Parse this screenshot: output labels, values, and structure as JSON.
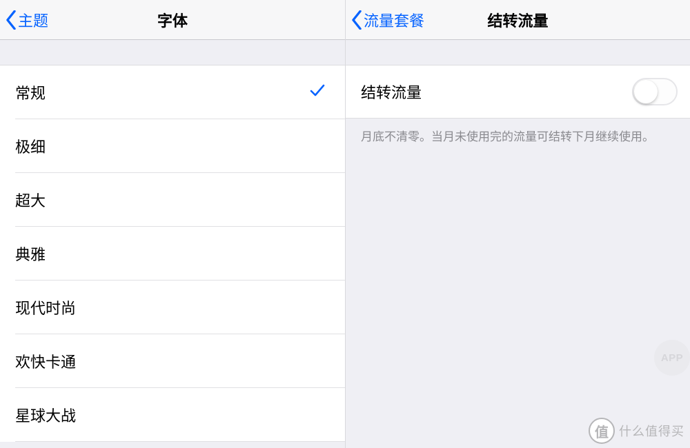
{
  "left": {
    "back_label": "主题",
    "title": "字体",
    "options": [
      {
        "label": "常规",
        "selected": true
      },
      {
        "label": "极细",
        "selected": false
      },
      {
        "label": "超大",
        "selected": false
      },
      {
        "label": "典雅",
        "selected": false
      },
      {
        "label": "现代时尚",
        "selected": false
      },
      {
        "label": "欢快卡通",
        "selected": false
      },
      {
        "label": "星球大战",
        "selected": false
      }
    ]
  },
  "right": {
    "back_label": "流量套餐",
    "title": "结转流量",
    "toggle": {
      "label": "结转流量",
      "on": false
    },
    "footer": "月底不清零。当月未使用完的流量可结转下月继续使用。"
  },
  "watermark": {
    "app_badge": "APP",
    "site_text": "什么值得买",
    "site_badge": "值"
  }
}
